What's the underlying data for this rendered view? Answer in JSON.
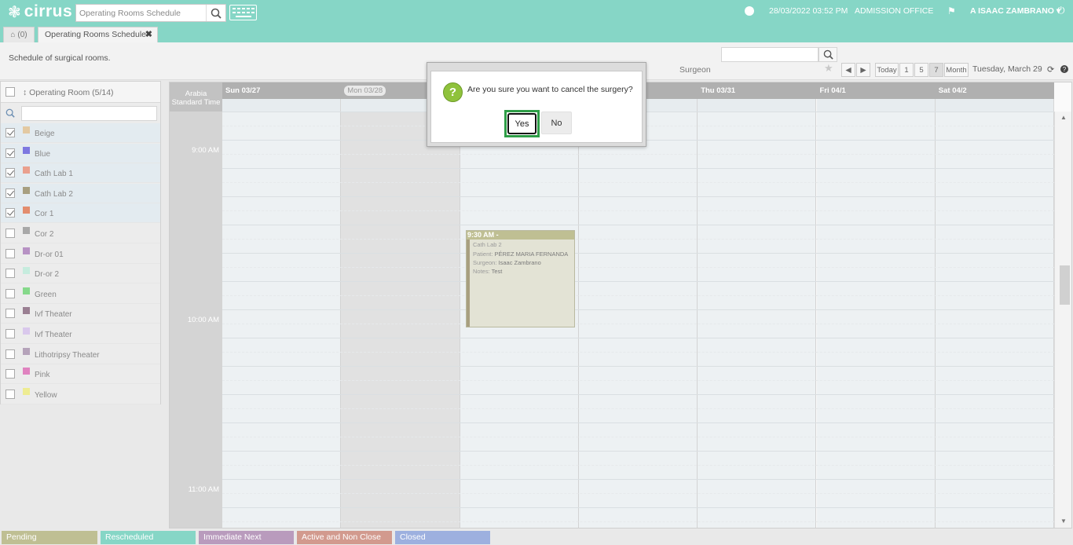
{
  "app": {
    "logo_text": "cirrus"
  },
  "topbar": {
    "search_value": "Operating Rooms Schedule",
    "datetime": "28/03/2022 03:52 PM",
    "office": "ADMISSION OFFICE",
    "user": "A ISAAC ZAMBRANO ▾"
  },
  "tabs": {
    "home_count": "(0)",
    "active_label": "Operating Rooms Schedule",
    "close": "✖"
  },
  "subheader": {
    "description": "Schedule of surgical rooms.",
    "surgeon_label": "Surgeon",
    "nav": {
      "today": "Today",
      "d1": "1",
      "d5": "5",
      "d7": "7",
      "month": "Month"
    },
    "current_date": "Tuesday, March 29"
  },
  "rooms_panel": {
    "title": "↕ Operating Room (5/14)",
    "rooms": [
      {
        "name": "Beige",
        "checked": true,
        "color": "#e3c9a2"
      },
      {
        "name": "Blue",
        "checked": true,
        "color": "#7e78e0"
      },
      {
        "name": "Cath Lab 1",
        "checked": true,
        "color": "#eaa08e"
      },
      {
        "name": "Cath Lab 2",
        "checked": true,
        "color": "#a89f80"
      },
      {
        "name": "Cor 1",
        "checked": true,
        "color": "#e38d6e"
      },
      {
        "name": "Cor 2",
        "checked": false,
        "color": "#a8a8a8"
      },
      {
        "name": "Dr-or 01",
        "checked": false,
        "color": "#b792c4"
      },
      {
        "name": "Dr-or 2",
        "checked": false,
        "color": "#c6ecde"
      },
      {
        "name": "Green",
        "checked": false,
        "color": "#86d98b"
      },
      {
        "name": "Ivf Theater",
        "checked": false,
        "color": "#9a7f92"
      },
      {
        "name": "Ivf Theater",
        "checked": false,
        "color": "#d9c8ec"
      },
      {
        "name": "Lithotripsy Theater",
        "checked": false,
        "color": "#b5a3ba"
      },
      {
        "name": "Pink",
        "checked": false,
        "color": "#e083c0"
      },
      {
        "name": "Yellow",
        "checked": false,
        "color": "#eeec92"
      }
    ]
  },
  "calendar": {
    "timezone": "Arabia Standard Time",
    "days": [
      "Sun 03/27",
      "Mon 03/28",
      "",
      "",
      "Thu 03/31",
      "Fri 04/1",
      "Sat 04/2"
    ],
    "times": [
      "9:00 AM",
      "10:00 AM",
      "11:00 AM"
    ],
    "event": {
      "time": "9:30 AM -",
      "room": "Cath Lab 2",
      "patient_label": "Patient:",
      "patient": "PÉREZ MARIA FERNANDA",
      "surgeon_label": "Surgeon:",
      "surgeon": "Isaac Zambrano",
      "notes_label": "Notes:",
      "notes": "Test"
    }
  },
  "legend": [
    {
      "label": "Pending",
      "color": "#bfbf93"
    },
    {
      "label": "Rescheduled",
      "color": "#86d6c6"
    },
    {
      "label": "Immediate Next",
      "color": "#b99bbd"
    },
    {
      "label": "Active and Non Close",
      "color": "#d29a8e"
    },
    {
      "label": "Closed",
      "color": "#9db0df"
    }
  ],
  "dialog": {
    "message": "Are you sure you want to cancel the surgery?",
    "yes": "Yes",
    "no": "No"
  }
}
